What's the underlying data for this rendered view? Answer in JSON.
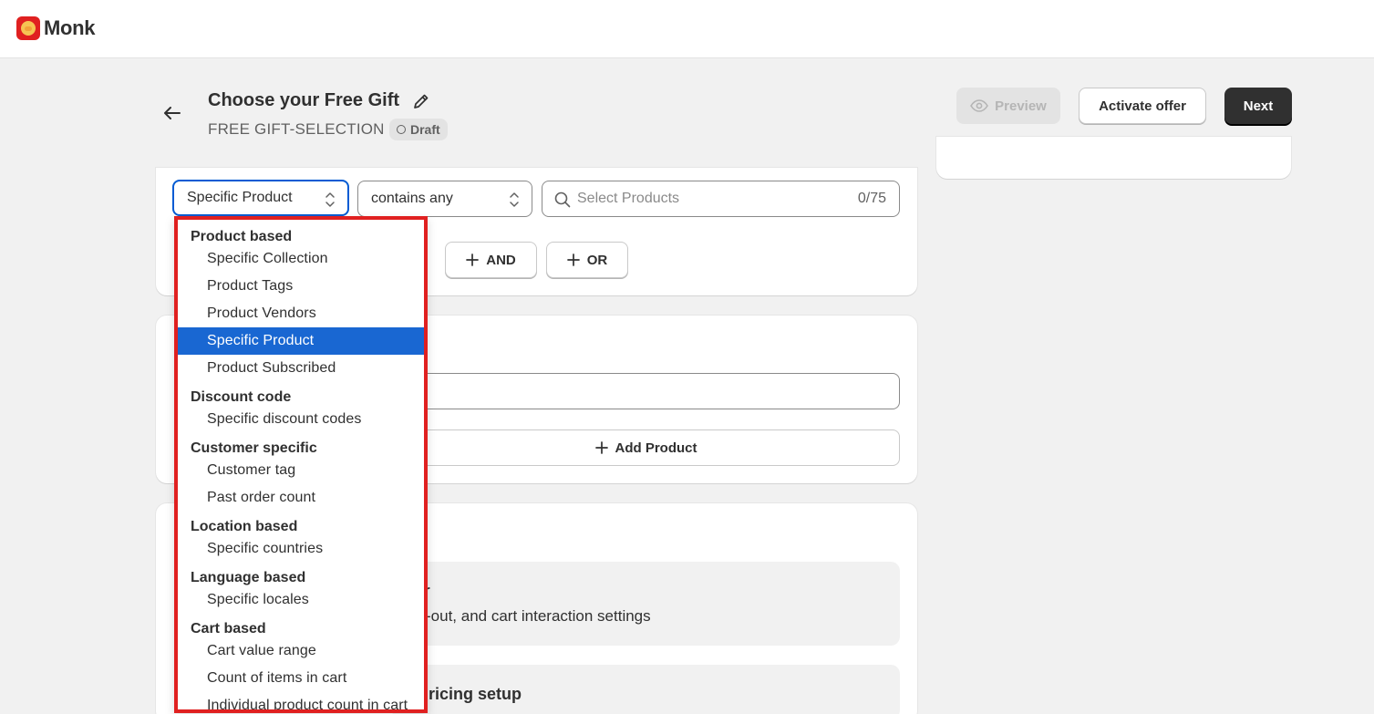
{
  "app": {
    "name": "Monk"
  },
  "header": {
    "title": "Choose your Free Gift",
    "subtitle": "FREE GIFT-SELECTION",
    "status_badge": "Draft",
    "buttons": {
      "preview": "Preview",
      "activate": "Activate offer",
      "next": "Next"
    }
  },
  "condition": {
    "type_value": "Specific Product",
    "operator_value": "contains any",
    "search_placeholder": "Select Products",
    "count": "0/75",
    "and_label": "AND",
    "or_label": "OR"
  },
  "products_section": {
    "add_product_label": "Add Product"
  },
  "settings_section": {
    "card1_title_visible": "r",
    "card1_desc_visible": "-out, and cart interaction settings",
    "card2_title_visible": "ricing setup"
  },
  "dropdown": {
    "groups": [
      {
        "label": "Product based",
        "items": [
          "Specific Collection",
          "Product Tags",
          "Product Vendors",
          "Specific Product",
          "Product Subscribed"
        ]
      },
      {
        "label": "Discount code",
        "items": [
          "Specific discount codes"
        ]
      },
      {
        "label": "Customer specific",
        "items": [
          "Customer tag",
          "Past order count"
        ]
      },
      {
        "label": "Location based",
        "items": [
          "Specific countries"
        ]
      },
      {
        "label": "Language based",
        "items": [
          "Specific locales"
        ]
      },
      {
        "label": "Cart based",
        "items": [
          "Cart value range",
          "Count of items in cart",
          "Individual product count in cart"
        ]
      }
    ],
    "selected": "Specific Product"
  },
  "colors": {
    "accent": "#005bd3",
    "highlight": "#1967d2",
    "annotation_border": "#e02020",
    "primary_button": "#303030"
  }
}
